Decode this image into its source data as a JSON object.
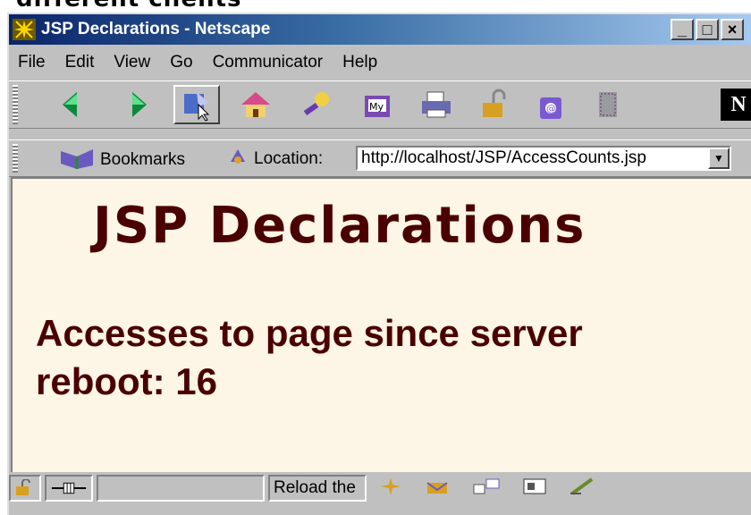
{
  "caption": "different clients",
  "window": {
    "title": "JSP Declarations - Netscape",
    "controls": [
      "_",
      "□",
      "×"
    ]
  },
  "menu": [
    "File",
    "Edit",
    "View",
    "Go",
    "Communicator",
    "Help"
  ],
  "nav_toolbar": {
    "buttons": [
      "back-icon",
      "forward-icon",
      "reload-icon",
      "home-icon",
      "search-icon",
      "my-netscape-icon",
      "print-icon",
      "security-icon",
      "shop-icon",
      "stop-icon"
    ],
    "logo": "N"
  },
  "location_toolbar": {
    "bookmarks_label": "Bookmarks",
    "location_label": "Location:",
    "url": "http://localhost/JSP/AccessCounts.jsp"
  },
  "page": {
    "heading": "JSP Declarations",
    "access_text": "Accesses to page since server reboot: 16"
  },
  "status": {
    "message": "Reload the"
  }
}
